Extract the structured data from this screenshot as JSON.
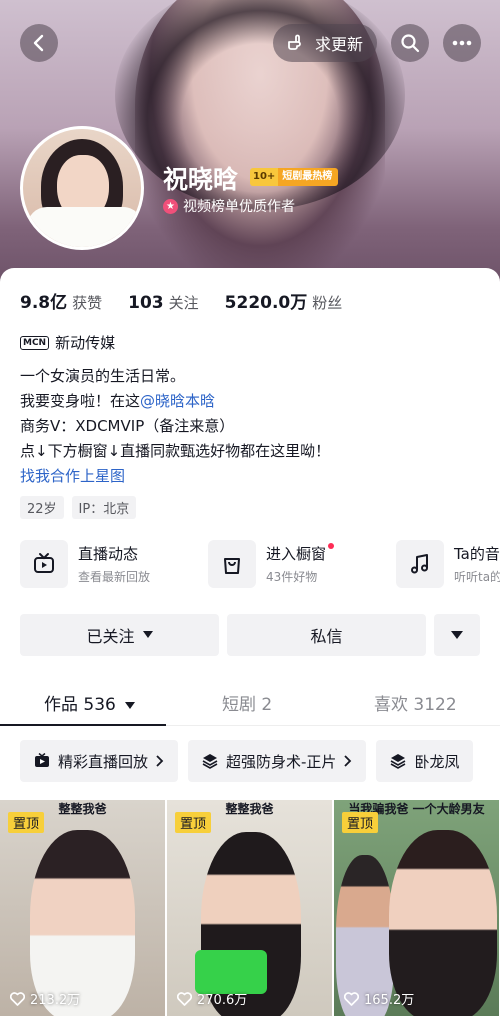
{
  "header": {
    "request_update_label": "求更新",
    "name": "祝晓晗",
    "rank_number": "10+",
    "rank_label": "短剧最热榜",
    "certification": "视频榜单优质作者"
  },
  "stats": [
    {
      "value": "9.8亿",
      "label": "获赞"
    },
    {
      "value": "103",
      "label": "关注"
    },
    {
      "value": "5220.0万",
      "label": "粉丝"
    }
  ],
  "org": {
    "badge": "MCN",
    "name": "新动传媒"
  },
  "bio": {
    "line1": "一个女演员的生活日常。",
    "line2_prefix": "我要变身啦！在这",
    "line2_link": "@晓晗本晗",
    "line3": "商务V：XDCMVIP（备注来意）",
    "line4": "点↓下方橱窗↓直播同款甄选好物都在这里呦！",
    "line5_link": "找我合作上星图"
  },
  "tags": [
    "22岁",
    "IP：北京"
  ],
  "services": [
    {
      "title": "直播动态",
      "subtitle": "查看最新回放",
      "icon": "tv-icon"
    },
    {
      "title": "进入橱窗",
      "subtitle": "43件好物",
      "icon": "shopping-bag-icon"
    },
    {
      "title": "Ta的音乐",
      "subtitle": "听听ta的歌",
      "icon": "music-note-icon"
    }
  ],
  "actions": {
    "followed_label": "已关注",
    "message_label": "私信"
  },
  "tabs": [
    {
      "label": "作品 536"
    },
    {
      "label": "短剧 2"
    },
    {
      "label": "喜欢 3122"
    }
  ],
  "chips": [
    {
      "label": "精彩直播回放",
      "icon": "play-icon"
    },
    {
      "label": "超强防身术-正片",
      "icon": "layers-icon"
    },
    {
      "label": "卧龙凤",
      "icon": "layers-icon"
    }
  ],
  "videos": [
    {
      "caption": "整整我爸",
      "pinned": "置顶",
      "views": "213.2万"
    },
    {
      "caption": "整整我爸",
      "pinned": "置顶",
      "views": "270.6万"
    },
    {
      "caption": "当我骗我爸 一个大龄男友",
      "pinned": "置顶",
      "views": "165.2万"
    }
  ],
  "colors": {
    "accent": "#fe2c55",
    "link": "#2d64c8",
    "pin": "#f7cf3a",
    "rank": "#f5a623"
  }
}
